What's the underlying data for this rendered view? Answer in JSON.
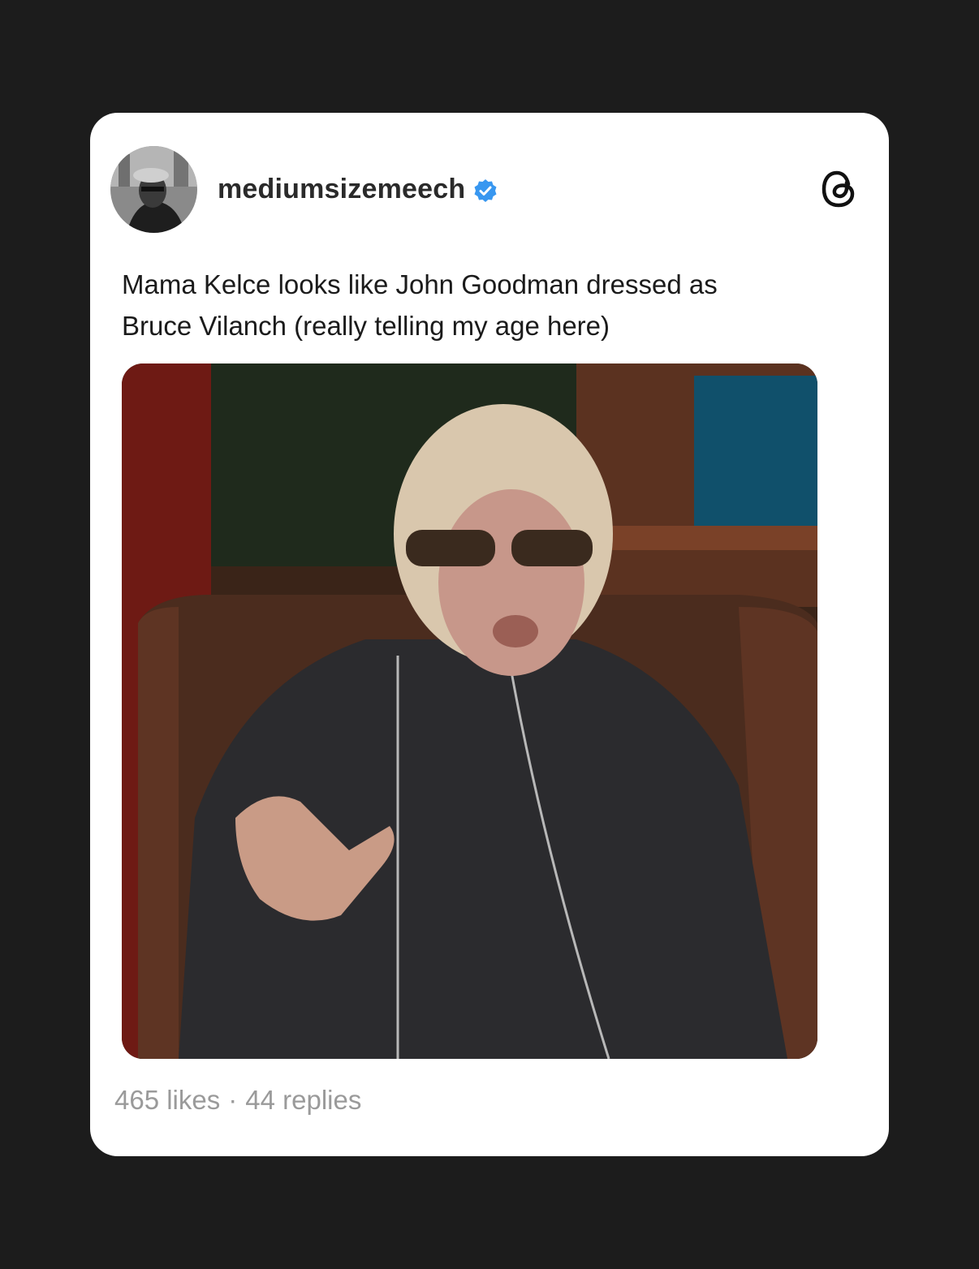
{
  "post": {
    "author": {
      "username": "mediumsizemeech",
      "verified": true,
      "avatar_icon": "avatar-photo",
      "verified_icon": "verified-badge-icon",
      "verified_color": "#3897f0"
    },
    "app_icon": "threads-logo-icon",
    "text_line_1": "Mama Kelce looks like John Goodman dressed as",
    "text_line_2": "Bruce Vilanch (really telling my age here)",
    "media_icon": "post-photo",
    "stats": {
      "likes": "465 likes",
      "separator": "·",
      "replies": "44 replies"
    }
  },
  "colors": {
    "background": "#1c1c1c",
    "card": "#ffffff",
    "text": "#1b1b1b",
    "muted": "#9a9a9a"
  }
}
